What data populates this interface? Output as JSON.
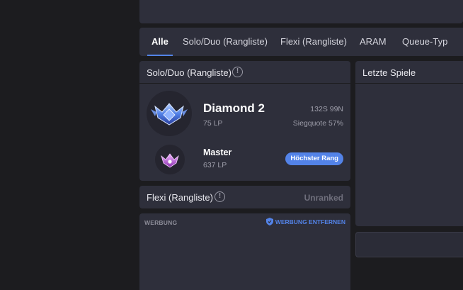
{
  "tabs": [
    {
      "label": "Alle",
      "active": true
    },
    {
      "label": "Solo/Duo (Rangliste)",
      "active": false
    },
    {
      "label": "Flexi (Rangliste)",
      "active": false
    },
    {
      "label": "ARAM",
      "active": false
    },
    {
      "label": "Queue-Typ",
      "active": false
    }
  ],
  "solo_duo": {
    "title": "Solo/Duo (Rangliste)",
    "info_icon": "info-icon",
    "current": {
      "emblem": "diamond-emblem-icon",
      "rank": "Diamond 2",
      "lp": "75 LP",
      "record": "132S 99N",
      "winrate": "Siegquote 57%"
    },
    "peak": {
      "emblem": "master-emblem-icon",
      "rank": "Master",
      "lp": "637 LP",
      "badge": "Höchster Rang"
    }
  },
  "flex": {
    "title": "Flexi (Rangliste)",
    "info_icon": "info-icon",
    "status": "Unranked"
  },
  "ad": {
    "label": "WERBUNG",
    "remove_label": "WERBUNG ENTFERNEN",
    "remove_icon": "shield-icon"
  },
  "recent_games": {
    "title": "Letzte Spiele"
  },
  "colors": {
    "background": "#1c1c1f",
    "panel": "#2e2f3b",
    "accent": "#5383e8",
    "muted_text": "#9e9eaa"
  }
}
